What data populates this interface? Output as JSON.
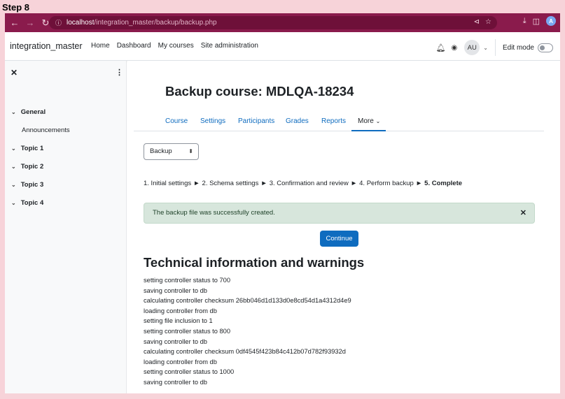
{
  "step_label": "Step 8",
  "browser": {
    "url_host": "localhost",
    "url_path": "/integration_master/backup/backup.php",
    "profile_initial": "A"
  },
  "navbar": {
    "brand": "integration_master",
    "links": [
      "Home",
      "Dashboard",
      "My courses",
      "Site administration"
    ],
    "avatar_initials": "AU",
    "edit_mode_label": "Edit mode"
  },
  "drawer": {
    "sections": [
      "General",
      "Topic 1",
      "Topic 2",
      "Topic 3",
      "Topic 4"
    ],
    "general_activity": "Announcements"
  },
  "main": {
    "title": "Backup course: MDLQA-18234",
    "tabs": [
      "Course",
      "Settings",
      "Participants",
      "Grades",
      "Reports",
      "More"
    ],
    "select_value": "Backup",
    "progress_steps": [
      "1. Initial settings",
      "2. Schema settings",
      "3. Confirmation and review",
      "4. Perform backup",
      "5. Complete"
    ],
    "progress_separator": "►",
    "alert_text": "The backup file was successfully created.",
    "continue_label": "Continue",
    "tech_title": "Technical information and warnings",
    "log_lines": [
      "setting controller status to 700",
      "saving controller to db",
      "calculating controller checksum 26bb046d1d133d0e8cd54d1a4312d4e9",
      "loading controller from db",
      "setting file inclusion to 1",
      "setting controller status to 800",
      "saving controller to db",
      "calculating controller checksum 0df4545f423b84c412b07d782f93932d",
      "loading controller from db",
      "setting controller status to 1000",
      "saving controller to db"
    ]
  },
  "colors": {
    "chrome_bg": "#8a1b4c",
    "link": "#0f6cbf",
    "primary_button": "#0f6cbf",
    "alert_bg": "#d7e6dc"
  }
}
